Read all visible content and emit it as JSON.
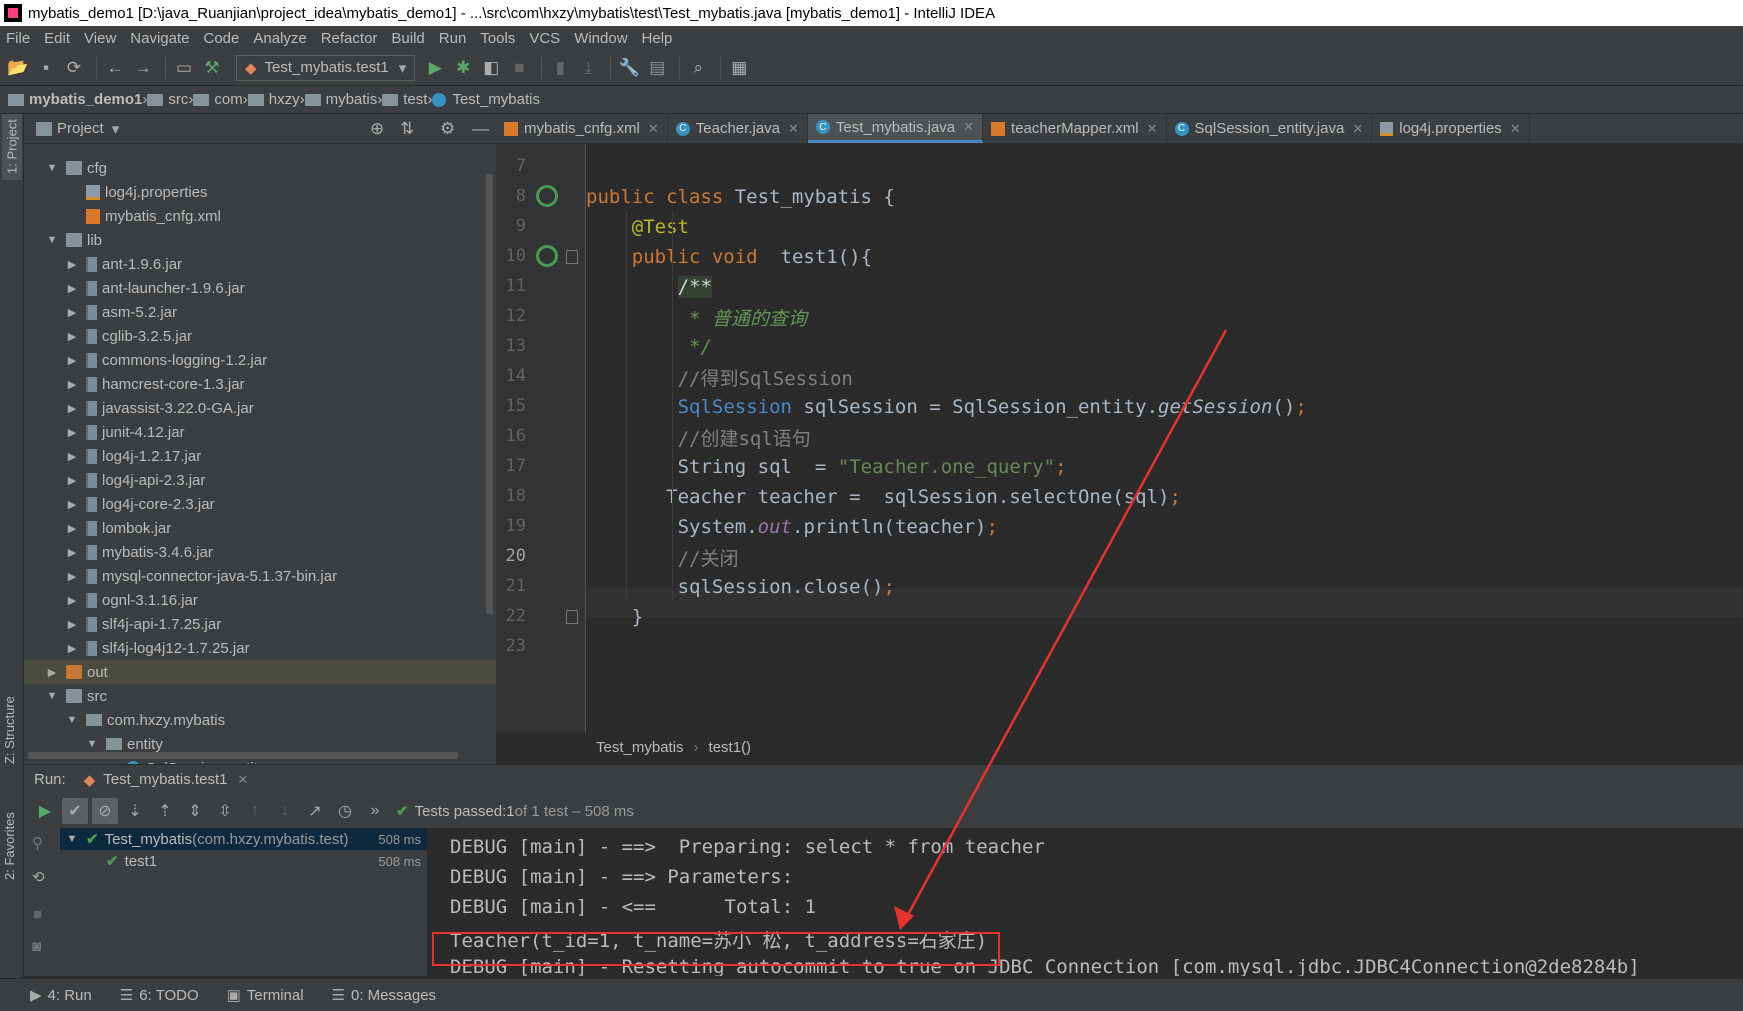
{
  "window": {
    "title": "mybatis_demo1 [D:\\java_Ruanjian\\project_idea\\mybatis_demo1] - ...\\src\\com\\hxzy\\mybatis\\test\\Test_mybatis.java [mybatis_demo1] - IntelliJ IDEA"
  },
  "menu": [
    "File",
    "Edit",
    "View",
    "Navigate",
    "Code",
    "Analyze",
    "Refactor",
    "Build",
    "Run",
    "Tools",
    "VCS",
    "Window",
    "Help"
  ],
  "toolbar": {
    "run_config": "Test_mybatis.test1"
  },
  "breadcrumb": [
    "mybatis_demo1",
    "src",
    "com",
    "hxzy",
    "mybatis",
    "test",
    "Test_mybatis"
  ],
  "side_tabs": {
    "project": "1: Project",
    "structure": "Z: Structure",
    "favorites": "2: Favorites"
  },
  "project": {
    "title": "Project",
    "tree": [
      {
        "label": "cfg",
        "indent": 1,
        "arrow": "down",
        "icon": "folder"
      },
      {
        "label": "log4j.properties",
        "indent": 2,
        "arrow": "",
        "icon": "props"
      },
      {
        "label": "mybatis_cnfg.xml",
        "indent": 2,
        "arrow": "",
        "icon": "xml"
      },
      {
        "label": "lib",
        "indent": 1,
        "arrow": "down",
        "icon": "folder"
      },
      {
        "label": "ant-1.9.6.jar",
        "indent": 2,
        "arrow": "right",
        "icon": "jar"
      },
      {
        "label": "ant-launcher-1.9.6.jar",
        "indent": 2,
        "arrow": "right",
        "icon": "jar"
      },
      {
        "label": "asm-5.2.jar",
        "indent": 2,
        "arrow": "right",
        "icon": "jar"
      },
      {
        "label": "cglib-3.2.5.jar",
        "indent": 2,
        "arrow": "right",
        "icon": "jar"
      },
      {
        "label": "commons-logging-1.2.jar",
        "indent": 2,
        "arrow": "right",
        "icon": "jar"
      },
      {
        "label": "hamcrest-core-1.3.jar",
        "indent": 2,
        "arrow": "right",
        "icon": "jar"
      },
      {
        "label": "javassist-3.22.0-GA.jar",
        "indent": 2,
        "arrow": "right",
        "icon": "jar"
      },
      {
        "label": "junit-4.12.jar",
        "indent": 2,
        "arrow": "right",
        "icon": "jar"
      },
      {
        "label": "log4j-1.2.17.jar",
        "indent": 2,
        "arrow": "right",
        "icon": "jar"
      },
      {
        "label": "log4j-api-2.3.jar",
        "indent": 2,
        "arrow": "right",
        "icon": "jar"
      },
      {
        "label": "log4j-core-2.3.jar",
        "indent": 2,
        "arrow": "right",
        "icon": "jar"
      },
      {
        "label": "lombok.jar",
        "indent": 2,
        "arrow": "right",
        "icon": "jar"
      },
      {
        "label": "mybatis-3.4.6.jar",
        "indent": 2,
        "arrow": "right",
        "icon": "jar"
      },
      {
        "label": "mysql-connector-java-5.1.37-bin.jar",
        "indent": 2,
        "arrow": "right",
        "icon": "jar"
      },
      {
        "label": "ognl-3.1.16.jar",
        "indent": 2,
        "arrow": "right",
        "icon": "jar"
      },
      {
        "label": "slf4j-api-1.7.25.jar",
        "indent": 2,
        "arrow": "right",
        "icon": "jar"
      },
      {
        "label": "slf4j-log4j12-1.7.25.jar",
        "indent": 2,
        "arrow": "right",
        "icon": "jar"
      },
      {
        "label": "out",
        "indent": 1,
        "arrow": "right",
        "icon": "folder-orange",
        "selected": true
      },
      {
        "label": "src",
        "indent": 1,
        "arrow": "down",
        "icon": "folder"
      },
      {
        "label": "com.hxzy.mybatis",
        "indent": 2,
        "arrow": "down",
        "icon": "pkg"
      },
      {
        "label": "entity",
        "indent": 3,
        "arrow": "down",
        "icon": "pkg"
      },
      {
        "label": "SqlSession_entity",
        "indent": 4,
        "arrow": "",
        "icon": "class"
      }
    ]
  },
  "editor": {
    "tabs": [
      {
        "label": "mybatis_cnfg.xml",
        "icon": "xml",
        "active": false
      },
      {
        "label": "Teacher.java",
        "icon": "class",
        "active": false
      },
      {
        "label": "Test_mybatis.java",
        "icon": "class",
        "active": true
      },
      {
        "label": "teacherMapper.xml",
        "icon": "xml",
        "active": false
      },
      {
        "label": "SqlSession_entity.java",
        "icon": "class",
        "active": false
      },
      {
        "label": "log4j.properties",
        "icon": "props",
        "active": false
      }
    ],
    "line_numbers": [
      "7",
      "8",
      "9",
      "10",
      "11",
      "12",
      "13",
      "14",
      "15",
      "16",
      "17",
      "18",
      "19",
      "20",
      "21",
      "22",
      "23"
    ],
    "current_line": "20",
    "lines": [
      {
        "indent": 0,
        "tokens": []
      },
      {
        "indent": 0,
        "tokens": [
          {
            "t": "public class ",
            "c": "kw"
          },
          {
            "t": "Test_mybatis {",
            "c": ""
          }
        ]
      },
      {
        "indent": 4,
        "tokens": [
          {
            "t": "@Test",
            "c": "ann"
          }
        ]
      },
      {
        "indent": 4,
        "tokens": [
          {
            "t": "public void ",
            "c": "kw"
          },
          {
            "t": " test1(){",
            "c": ""
          }
        ]
      },
      {
        "indent": 8,
        "tokens": [
          {
            "t": "/**",
            "c": "cmh"
          }
        ]
      },
      {
        "indent": 8,
        "tokens": [
          {
            "t": " * 普通的查询",
            "c": "cm"
          }
        ]
      },
      {
        "indent": 8,
        "tokens": [
          {
            "t": " */",
            "c": "cm"
          }
        ]
      },
      {
        "indent": 8,
        "tokens": [
          {
            "t": "//得到SqlSession",
            "c": "lc"
          }
        ]
      },
      {
        "indent": 8,
        "tokens": [
          {
            "t": "SqlSession",
            "c": "cls"
          },
          {
            "t": " sqlSession = SqlSession_entity.",
            "c": ""
          },
          {
            "t": "getSession",
            "c": "sm"
          },
          {
            "t": "()",
            "c": ""
          },
          {
            "t": ";",
            "c": "kw"
          }
        ]
      },
      {
        "indent": 8,
        "tokens": [
          {
            "t": "//创建sql语句",
            "c": "lc"
          }
        ]
      },
      {
        "indent": 8,
        "tokens": [
          {
            "t": "String sql  = ",
            "c": ""
          },
          {
            "t": "\"Teacher.one_query\"",
            "c": "str"
          },
          {
            "t": ";",
            "c": "kw"
          }
        ]
      },
      {
        "indent": 7,
        "tokens": [
          {
            "t": "Teacher teacher =  sqlSession.selectOne(sql)",
            "c": ""
          },
          {
            "t": ";",
            "c": "kw"
          }
        ]
      },
      {
        "indent": 8,
        "tokens": [
          {
            "t": "System.",
            "c": ""
          },
          {
            "t": "out",
            "c": "fld"
          },
          {
            "t": ".println(teacher)",
            "c": ""
          },
          {
            "t": ";",
            "c": "kw"
          }
        ]
      },
      {
        "indent": 8,
        "tokens": [
          {
            "t": "//关闭",
            "c": "lc"
          }
        ]
      },
      {
        "indent": 8,
        "tokens": [
          {
            "t": "sqlSession.close()",
            "c": ""
          },
          {
            "t": ";",
            "c": "kw"
          }
        ]
      },
      {
        "indent": 4,
        "tokens": [
          {
            "t": "}",
            "c": ""
          }
        ]
      },
      {
        "indent": 0,
        "tokens": []
      }
    ],
    "crumb": [
      "Test_mybatis",
      "test1()"
    ]
  },
  "run": {
    "label": "Run:",
    "tab": "Test_mybatis.test1",
    "status_prefix": "Tests passed: ",
    "status_count": "1",
    "status_suffix": " of 1 test – 508 ms",
    "tree": [
      {
        "name": "Test_mybatis",
        "pkg": " (com.hxzy.mybatis.test)",
        "time": "508 ms",
        "indent": 0
      },
      {
        "name": "test1",
        "pkg": "",
        "time": "508 ms",
        "indent": 1
      }
    ],
    "console": [
      "DEBUG [main] - ==>  Preparing: select * from teacher",
      "DEBUG [main] - ==> Parameters: ",
      "DEBUG [main] - <==      Total: 1",
      "Teacher(t_id=1, t_name=苏小 松, t_address=石家庄)",
      "DEBUG [main] - Resetting autocommit to true on JDBC Connection [com.mysql.jdbc.JDBC4Connection@2de8284b]"
    ]
  },
  "statusbar": [
    {
      "label": "4: Run",
      "icon": "play-icon"
    },
    {
      "label": "6: TODO",
      "icon": "list-icon"
    },
    {
      "label": "Terminal",
      "icon": "terminal-icon"
    },
    {
      "label": "0: Messages",
      "icon": "messages-icon"
    }
  ],
  "colors": {
    "annotation_red": "#e8322e",
    "accent_blue": "#4a88c7",
    "pass_green": "#499c54"
  }
}
